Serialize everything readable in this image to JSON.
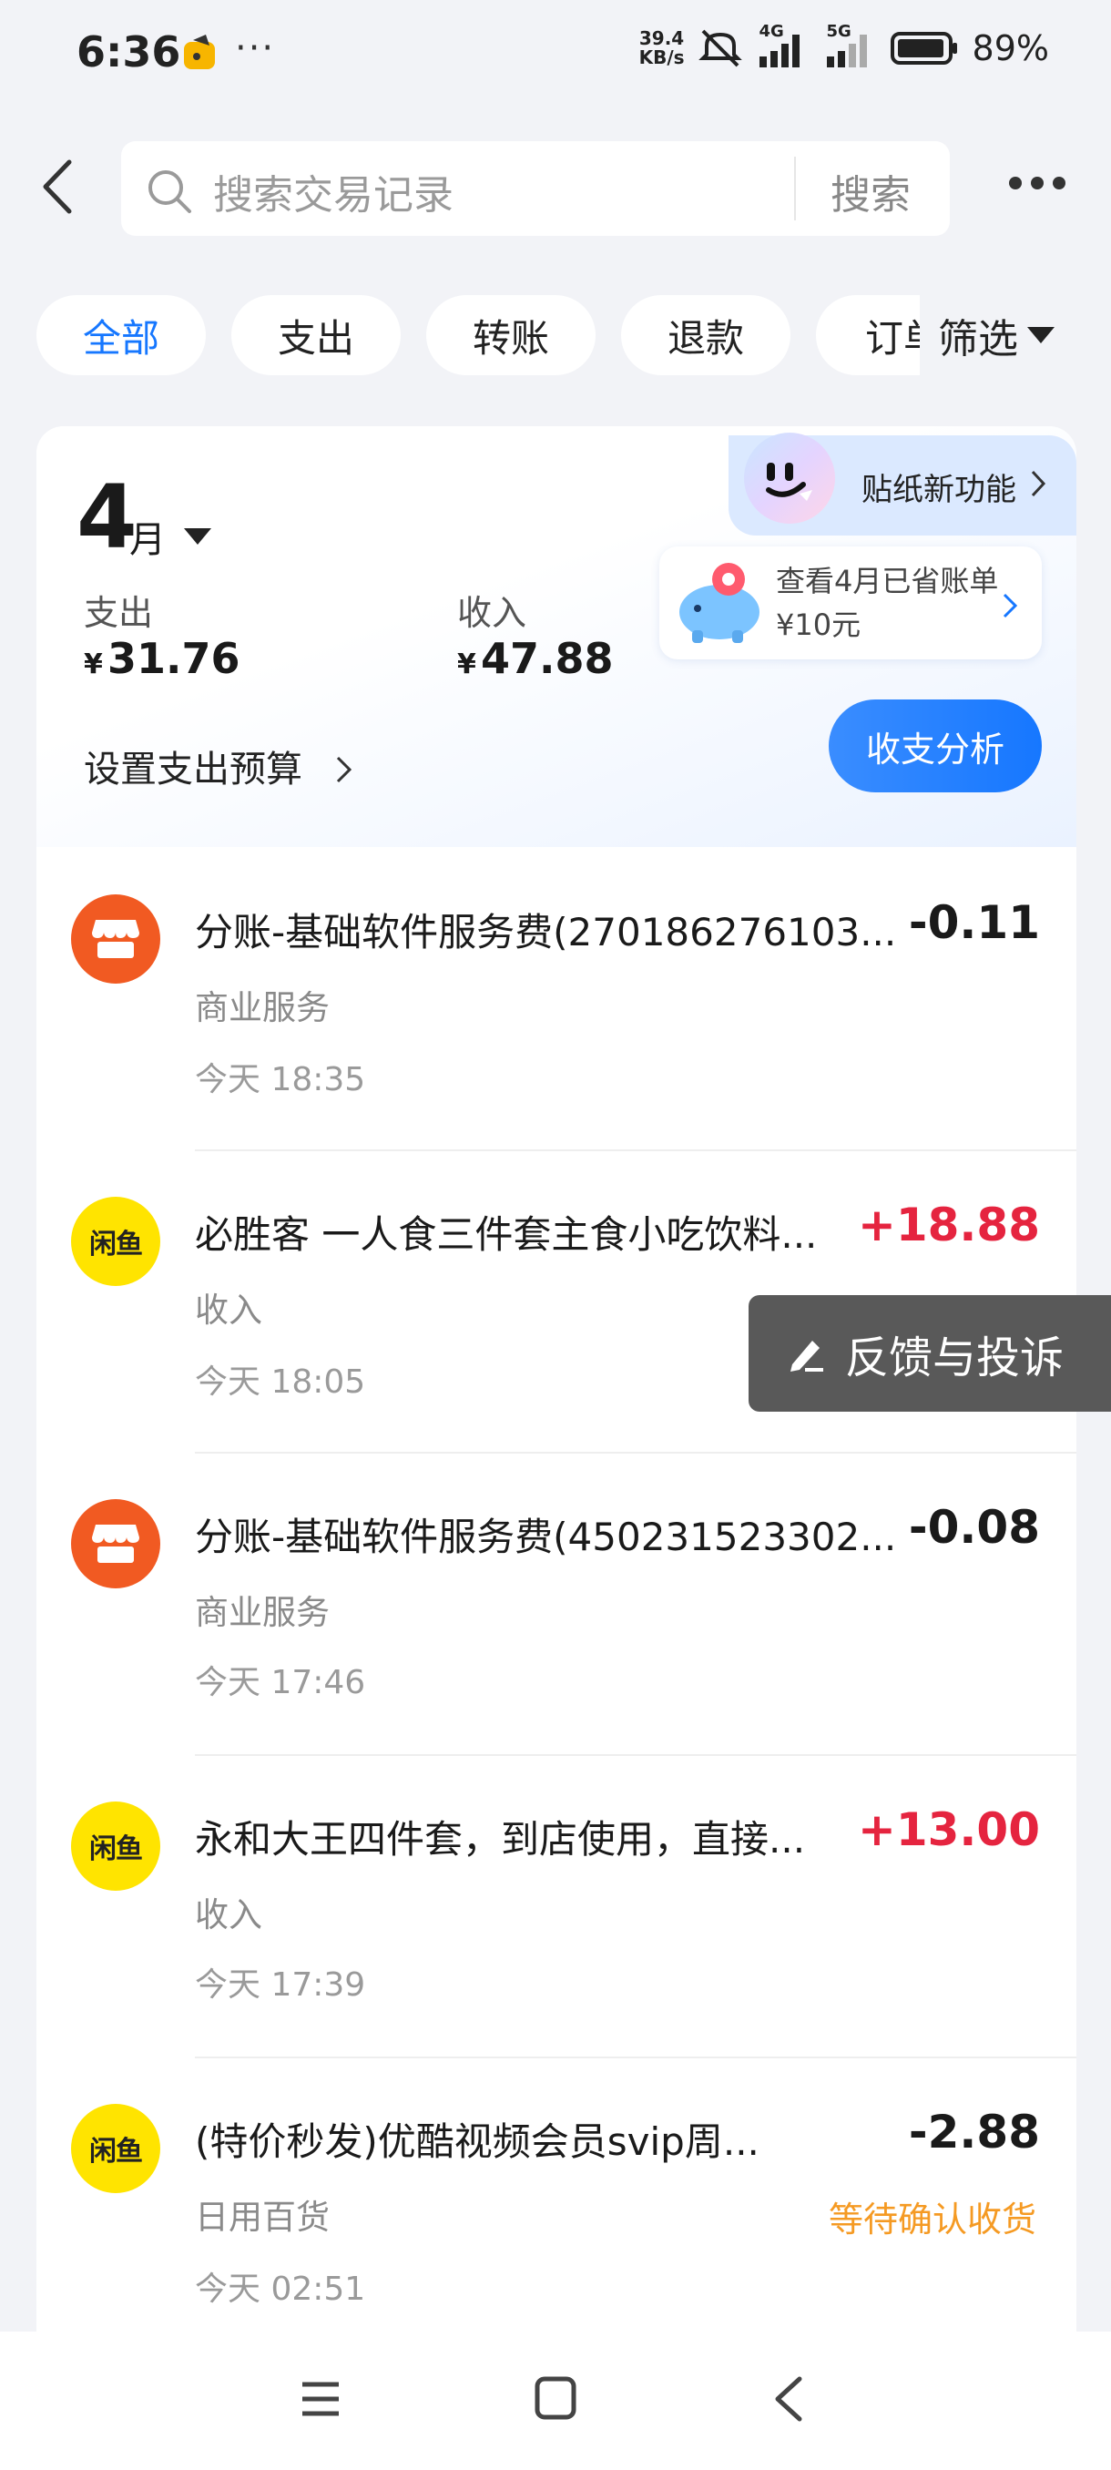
{
  "status_bar": {
    "time": "6:36",
    "dots": "···",
    "net_speed_value": "39.4",
    "net_speed_unit": "KB/s",
    "net1": "4G",
    "net2": "5G",
    "battery": "89%"
  },
  "search": {
    "placeholder": "搜索交易记录",
    "button": "搜索"
  },
  "filters": {
    "chips": [
      "全部",
      "支出",
      "转账",
      "退款",
      "订单"
    ],
    "active": "全部",
    "filter_label": "筛选"
  },
  "summary": {
    "month": "4",
    "month_unit": "月",
    "expense_label": "支出",
    "expense_currency": "¥",
    "expense_value": "31.76",
    "income_label": "收入",
    "income_currency": "¥",
    "income_value": "47.88",
    "budget_label": "设置支出预算",
    "analysis_button": "收支分析",
    "sticker_label": "贴纸新功能",
    "savings_text": "查看4月已省账单¥10元"
  },
  "transactions": [
    {
      "title": "分账-基础软件服务费(270186276103...",
      "amount": "-0.11",
      "category": "商业服务",
      "time": "今天 18:35",
      "icon": "shop-icon",
      "status": ""
    },
    {
      "title": "必胜客 一人食三件套主食小吃饮料...",
      "amount": "+18.88",
      "category": "收入",
      "time": "今天 18:05",
      "icon": "xianyu-icon",
      "status": ""
    },
    {
      "title": "分账-基础软件服务费(450231523302...",
      "amount": "-0.08",
      "category": "商业服务",
      "time": "今天 17:46",
      "icon": "shop-icon",
      "status": ""
    },
    {
      "title": "永和大王四件套，到店使用，直接...",
      "amount": "+13.00",
      "category": "收入",
      "time": "今天 17:39",
      "icon": "xianyu-icon",
      "status": ""
    },
    {
      "title": "(特价秒发)优酷视频会员svip周...",
      "amount": "-2.88",
      "category": "日用百货",
      "time": "今天 02:51",
      "icon": "xianyu-icon",
      "status": "等待确认收货"
    }
  ],
  "xianyu_logo_text": "闲鱼",
  "feedback": {
    "label": "反馈与投诉"
  },
  "colors": {
    "accent": "#1677ff",
    "positive": "#e5243f",
    "pending": "#f59a23",
    "shop_icon": "#f15a22",
    "xianyu_icon": "#ffe400"
  }
}
